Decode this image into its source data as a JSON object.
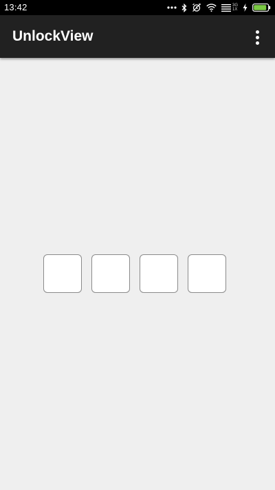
{
  "status_bar": {
    "time": "13:42",
    "icons": [
      "more-dots-icon",
      "bluetooth-icon",
      "alarm-off-icon",
      "wifi-icon",
      "signal-icon",
      "charging-icon",
      "battery-icon"
    ],
    "battery_level": 0.9,
    "battery_color": "#7ac943",
    "sim_label_top": "3G",
    "sim_label_bottom": "1X"
  },
  "app_bar": {
    "title": "UnlockView",
    "background": "#212121",
    "overflow_icon": "more-vert-icon"
  },
  "unlock_view": {
    "digits": [
      "",
      "",
      "",
      ""
    ],
    "box_border_color": "#8a8a8a"
  },
  "colors": {
    "background": "#efefef",
    "status_bar": "#000000"
  }
}
